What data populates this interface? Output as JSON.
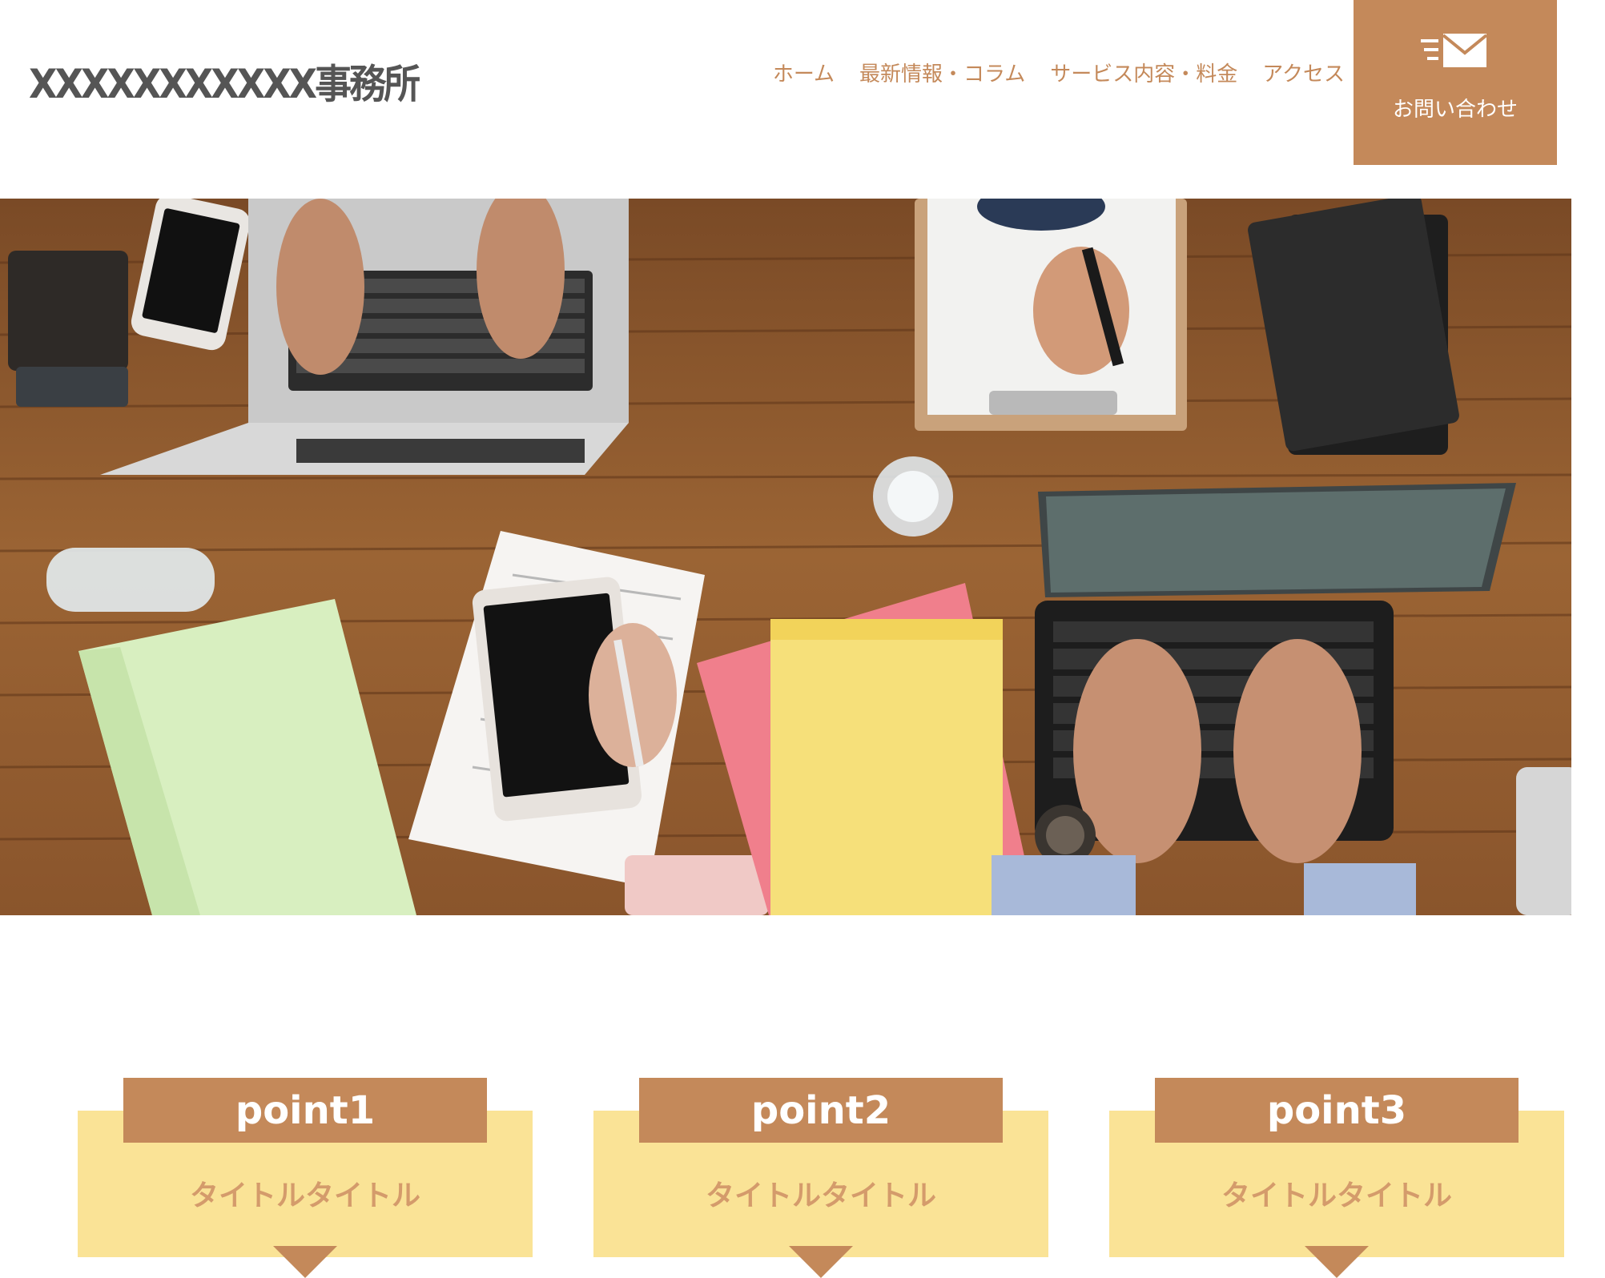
{
  "header": {
    "logo": "XXXXXXXXXXX事務所",
    "nav": [
      "ホーム",
      "最新情報・コラム",
      "サービス内容・料金",
      "アクセス"
    ],
    "contact_label": "お問い合わせ",
    "contact_icon": "mail-icon"
  },
  "colors": {
    "accent": "#c4895a",
    "point_background": "#fae396",
    "point_title": "#d49b6b"
  },
  "hero": {
    "image": "desk-photo"
  },
  "points": [
    {
      "label": "point1",
      "title": "タイトルタイトル"
    },
    {
      "label": "point2",
      "title": "タイトルタイトル"
    },
    {
      "label": "point3",
      "title": "タイトルタイトル"
    }
  ]
}
